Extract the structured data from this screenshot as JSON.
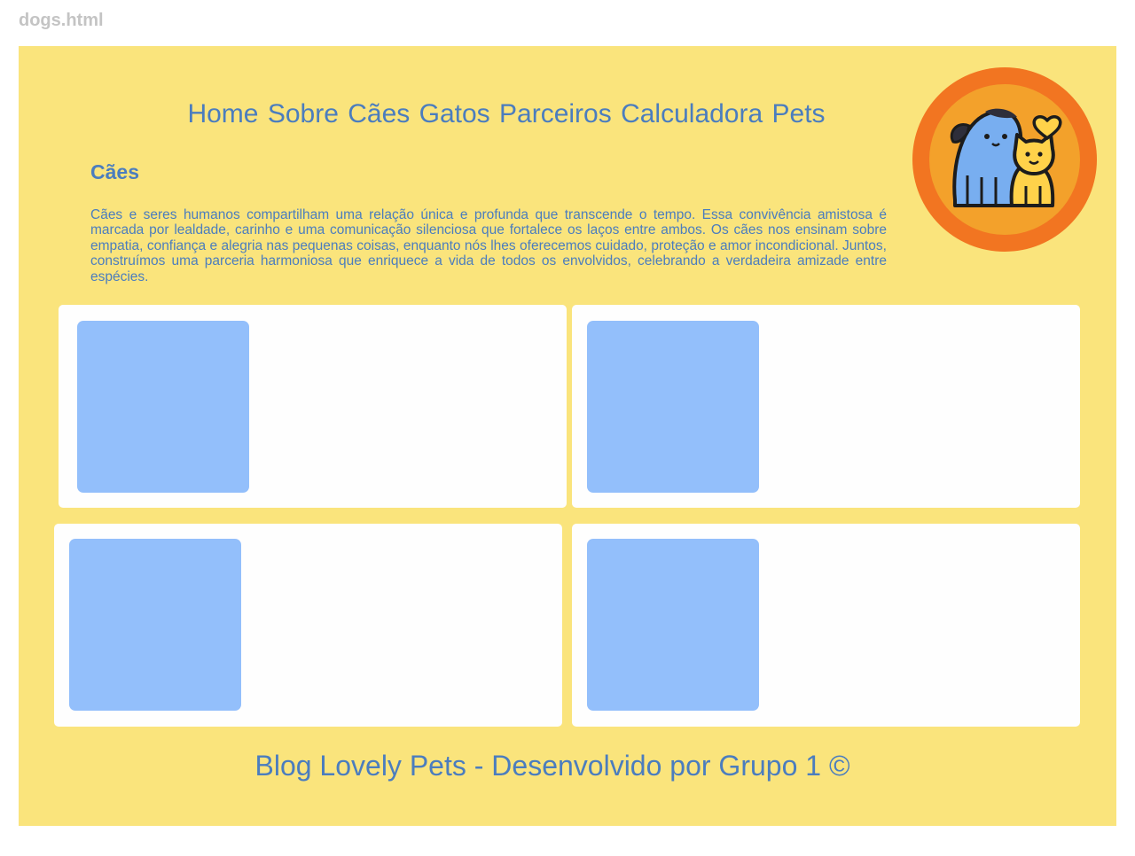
{
  "window": {
    "filename": "dogs.html"
  },
  "nav": {
    "items": [
      {
        "label": "Home"
      },
      {
        "label": "Sobre"
      },
      {
        "label": "Cães"
      },
      {
        "label": "Gatos"
      },
      {
        "label": "Parceiros"
      },
      {
        "label": "Calculadora Pets"
      }
    ]
  },
  "logo": {
    "icon": "dog-and-cat-heart-icon"
  },
  "main": {
    "title": "Cães",
    "intro": "Cães e seres humanos compartilham uma relação única e profunda que transcende o tempo. Essa convivência amistosa é marcada por lealdade, carinho e uma comunicação silenciosa que fortalece os laços entre ambos. Os cães nos ensinam sobre empatia, confiança e alegria nas pequenas coisas, enquanto nós lhes oferecemos cuidado, proteção e amor incondicional. Juntos, construímos uma parceria harmoniosa que enriquece a vida de todos os envolvidos, celebrando a verdadeira amizade entre espécies."
  },
  "footer": {
    "text": "Blog Lovely Pets - Desenvolvido por Grupo 1 ©"
  },
  "colors": {
    "background": "#fae47c",
    "text": "#4b7dbe",
    "card": "#fefefe",
    "thumb": "#93bffb",
    "logo_outer": "#f27521",
    "logo_inner": "#f3a12b"
  }
}
